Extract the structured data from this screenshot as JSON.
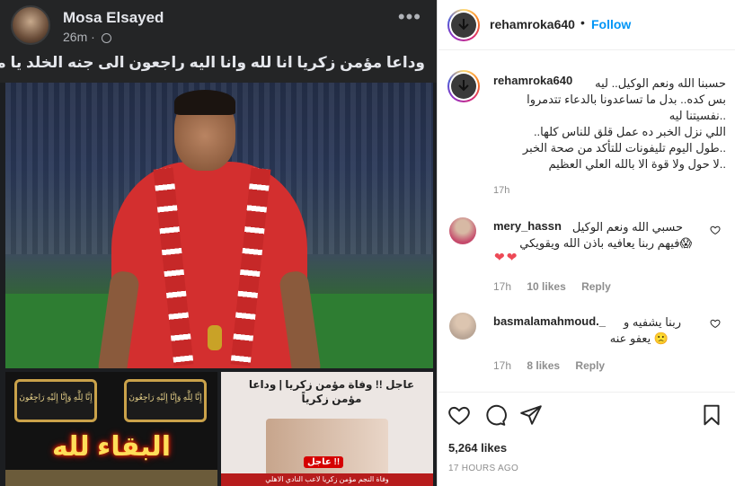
{
  "fb_post": {
    "author": "Mosa Elsayed",
    "time": "26m ·",
    "menu_glyph": "•••",
    "caption": "وداعا مؤمن زكريا انا لله وانا اليه راجعون الى جنه الخلد يا مؤمن",
    "left_banner_text": "إِنَّا لِلَّٰهِ وَإِنَّا إِلَيْهِ رَاجِعُونَ",
    "left_big_text": "البقاء لله",
    "right_title": "عاجل !! وفاة مؤمن زكريا | وداعا مؤمن زكرياً",
    "right_urgent": "عاجل !!",
    "right_bottom": "وفاة النجم مؤمن زكريا لاعب النادي الاهلي"
  },
  "header": {
    "username": "rehamroka640",
    "dot": "•",
    "follow_label": "Follow"
  },
  "caption": {
    "username": "rehamroka640",
    "lines": [
      "حسبنا الله ونعم الوكيل.. ليه",
      "بس كده.. بدل ما تساعدونا بالدعاء تتدمروا",
      "..نفسيتنا ليه",
      "اللي نزل الخبر ده عمل قلق للناس كلها..",
      "..طول اليوم تليفونات للتأكد من صحة الخبر",
      "..لا حول ولا قوة الا بالله العلي العظيم"
    ],
    "time": "17h"
  },
  "comments": [
    {
      "username": "mery_hassn",
      "line1": "حسبي الله ونعم الوكيل",
      "line2": "😱فيهم ربنا يعافيه باذن الله ويقويكي",
      "hearts": "❤❤",
      "time": "17h",
      "likes": "10 likes",
      "reply": "Reply"
    },
    {
      "username": "basmalamahmoud._",
      "line1": "ربنا يشفيه و",
      "line2": "🙁 يعفو عنه",
      "time": "17h",
      "likes": "8 likes",
      "reply": "Reply"
    }
  ],
  "footer": {
    "likes": "5,264 likes",
    "time_ago": "17 HOURS AGO"
  },
  "icons": {
    "like": "heart-icon",
    "comment": "comment-icon",
    "share": "share-icon",
    "save": "bookmark-icon"
  },
  "colors": {
    "accent": "#0095f6",
    "text": "#262626",
    "muted": "#8e8e8e",
    "heart": "#ed4956"
  }
}
